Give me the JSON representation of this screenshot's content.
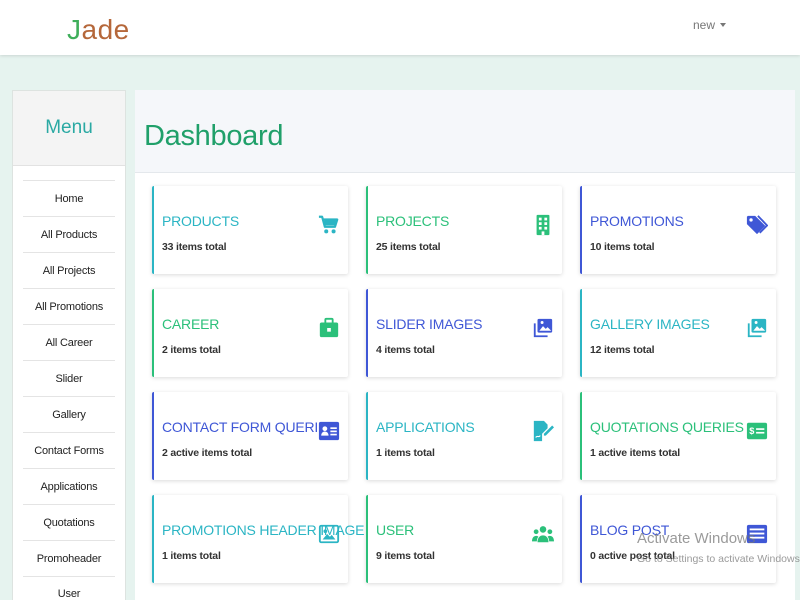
{
  "header": {
    "logo_first": "J",
    "logo_rest": "ade",
    "user_menu_label": "new"
  },
  "sidebar": {
    "title": "Menu",
    "items": [
      {
        "label": "Home"
      },
      {
        "label": "All Products"
      },
      {
        "label": "All Projects"
      },
      {
        "label": "All Promotions"
      },
      {
        "label": "All Career"
      },
      {
        "label": "Slider"
      },
      {
        "label": "Gallery"
      },
      {
        "label": "Contact Forms"
      },
      {
        "label": "Applications"
      },
      {
        "label": "Quotations"
      },
      {
        "label": "Promoheader"
      },
      {
        "label": "User"
      }
    ]
  },
  "dashboard": {
    "title": "Dashboard",
    "cards": [
      {
        "title": "PRODUCTS",
        "count": "33 items total",
        "icon": "cart-icon",
        "accent": "#2bb5c4"
      },
      {
        "title": "PROJECTS",
        "count": "25 items total",
        "icon": "building-icon",
        "accent": "#2bc07a"
      },
      {
        "title": "PROMOTIONS",
        "count": "10 items total",
        "icon": "tags-icon",
        "accent": "#3f57d6"
      },
      {
        "title": "CAREER",
        "count": "2 items total",
        "icon": "briefcase-icon",
        "accent": "#2bc07a"
      },
      {
        "title": "SLIDER IMAGES",
        "count": "4 items total",
        "icon": "images-icon",
        "accent": "#3f57d6"
      },
      {
        "title": "GALLERY IMAGES",
        "count": "12 items total",
        "icon": "images-icon",
        "accent": "#2bb5c4"
      },
      {
        "title": "CONTACT FORM QUERIES",
        "count": "2 active items total",
        "icon": "contact-card-icon",
        "accent": "#3f57d6"
      },
      {
        "title": "APPLICATIONS",
        "count": "1 items total",
        "icon": "file-signature-icon",
        "accent": "#2bb5c4"
      },
      {
        "title": "QUOTATIONS QUERIES",
        "count": "1 active items total",
        "icon": "money-check-icon",
        "accent": "#2bc07a"
      },
      {
        "title": "PROMOTIONS HEADER IMAGE",
        "count": "1 items total",
        "icon": "image-icon",
        "accent": "#2bb5c4"
      },
      {
        "title": "USER",
        "count": "9 items total",
        "icon": "users-icon",
        "accent": "#2bc07a"
      },
      {
        "title": "BLOG POST",
        "count": "0 active post total",
        "icon": "list-alt-icon",
        "accent": "#3f57d6"
      }
    ]
  },
  "watermark": {
    "line1": "Activate Windows",
    "line2": "Go to Settings to activate Windows."
  }
}
